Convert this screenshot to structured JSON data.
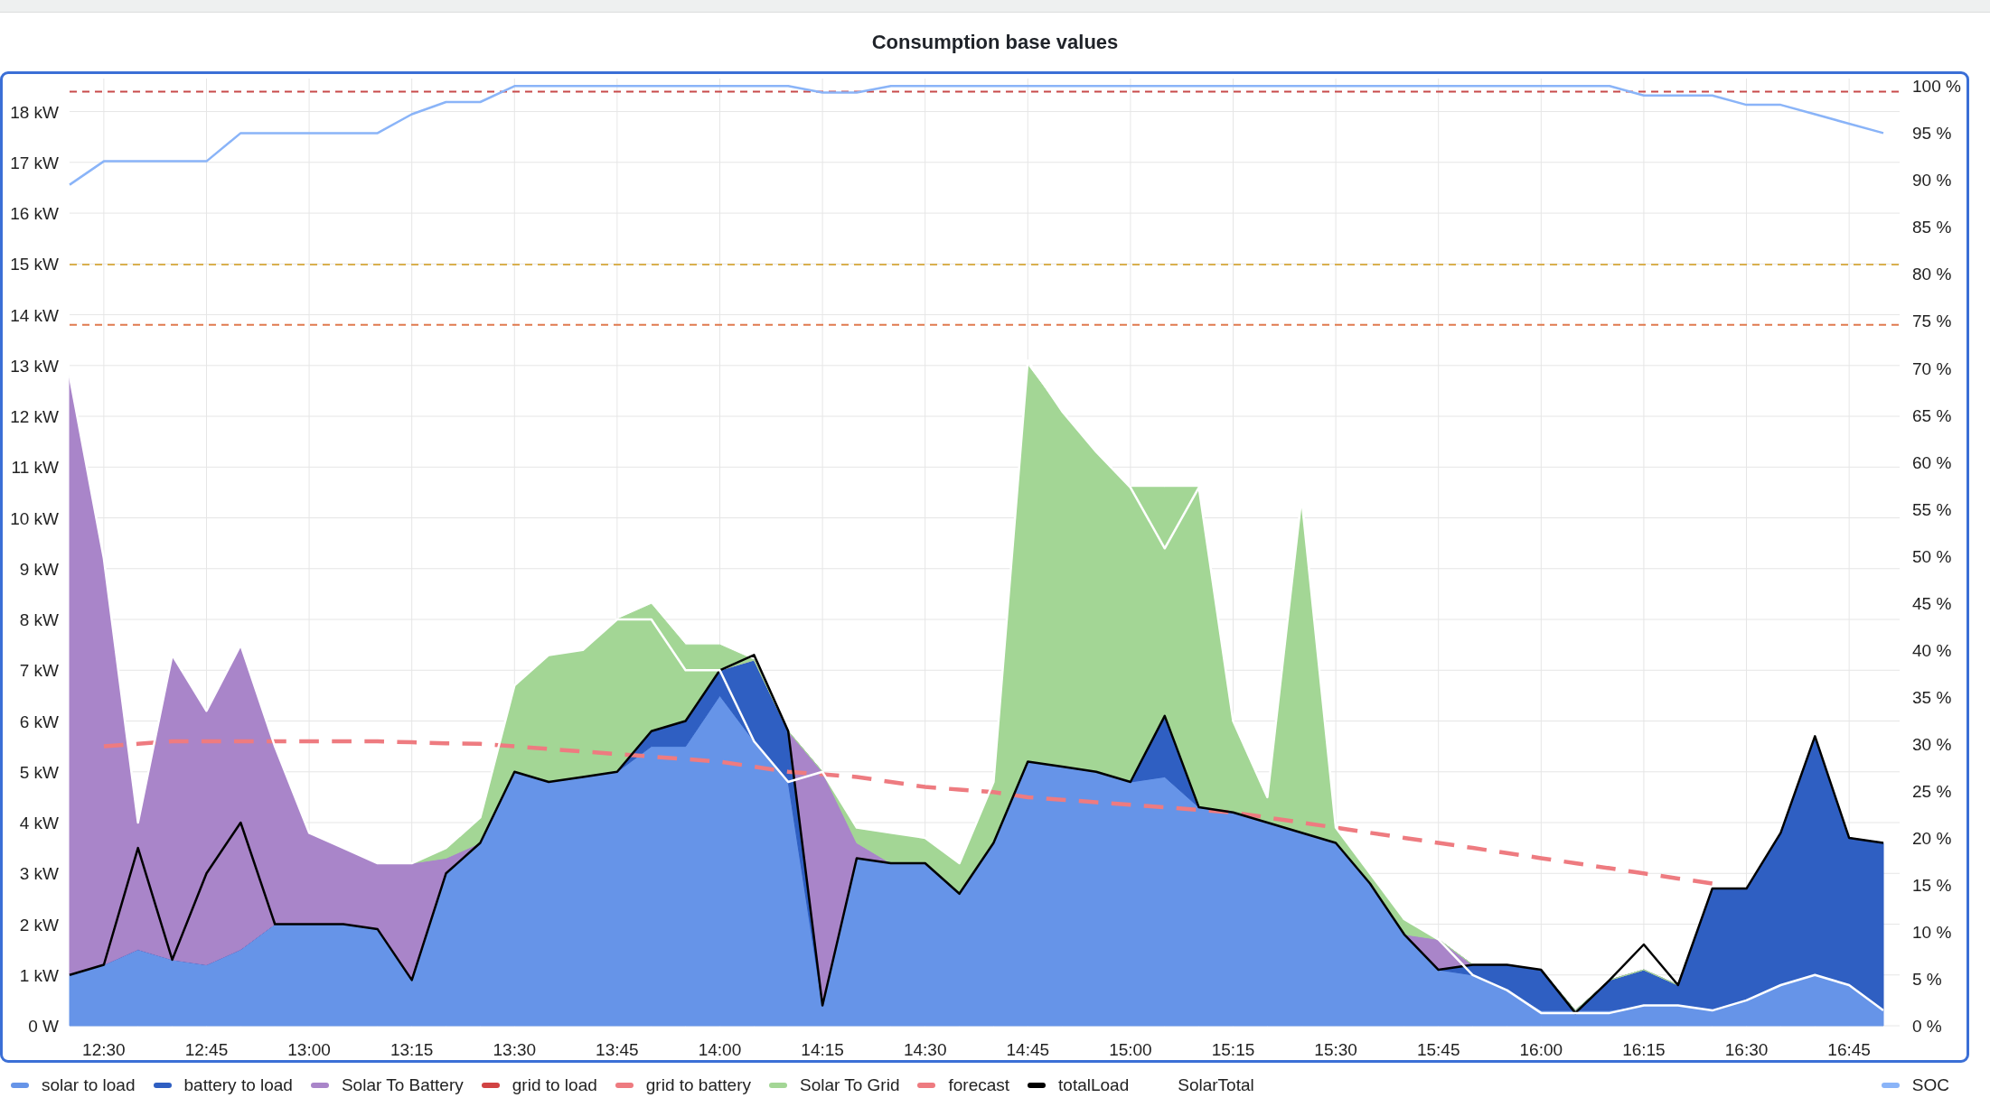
{
  "panel": {
    "title": "Consumption base values",
    "selected": true,
    "chart_data": {
      "type": "area",
      "stacked": true,
      "grid": true,
      "categories": [
        null,
        "12:30",
        null,
        null,
        "12:45",
        null,
        null,
        "13:00",
        null,
        null,
        "13:15",
        null,
        null,
        "13:30",
        null,
        null,
        "13:45",
        null,
        null,
        "14:00",
        null,
        null,
        "14:15",
        null,
        null,
        "14:30",
        null,
        null,
        "14:45",
        null,
        null,
        "15:00",
        null,
        null,
        "15:15",
        null,
        null,
        "15:30",
        null,
        null,
        "15:45",
        null,
        null,
        "16:00",
        null,
        null,
        "16:15",
        null,
        null,
        "16:30",
        null,
        null,
        "16:45",
        null
      ],
      "ylim": [
        0,
        18.65
      ],
      "yticks": [
        {
          "value": 0,
          "label": "0 W"
        },
        {
          "value": 1,
          "label": "1 kW"
        },
        {
          "value": 2,
          "label": "2 kW"
        },
        {
          "value": 3,
          "label": "3 kW"
        },
        {
          "value": 4,
          "label": "4 kW"
        },
        {
          "value": 5,
          "label": "5 kW"
        },
        {
          "value": 6,
          "label": "6 kW"
        },
        {
          "value": 7,
          "label": "7 kW"
        },
        {
          "value": 8,
          "label": "8 kW"
        },
        {
          "value": 9,
          "label": "9 kW"
        },
        {
          "value": 10,
          "label": "10 kW"
        },
        {
          "value": 11,
          "label": "11 kW"
        },
        {
          "value": 12,
          "label": "12 kW"
        },
        {
          "value": 13,
          "label": "13 kW"
        },
        {
          "value": 14,
          "label": "14 kW"
        },
        {
          "value": 15,
          "label": "15 kW"
        },
        {
          "value": 16,
          "label": "16 kW"
        },
        {
          "value": 17,
          "label": "17 kW"
        },
        {
          "value": 18,
          "label": "18 kW"
        }
      ],
      "y2lim": [
        0,
        100.8
      ],
      "y2ticks": [
        {
          "value": 0,
          "label": "0 %"
        },
        {
          "value": 5,
          "label": "5 %"
        },
        {
          "value": 10,
          "label": "10 %"
        },
        {
          "value": 15,
          "label": "15 %"
        },
        {
          "value": 20,
          "label": "20 %"
        },
        {
          "value": 25,
          "label": "25 %"
        },
        {
          "value": 30,
          "label": "30 %"
        },
        {
          "value": 35,
          "label": "35 %"
        },
        {
          "value": 40,
          "label": "40 %"
        },
        {
          "value": 45,
          "label": "45 %"
        },
        {
          "value": 50,
          "label": "50 %"
        },
        {
          "value": 55,
          "label": "55 %"
        },
        {
          "value": 60,
          "label": "60 %"
        },
        {
          "value": 65,
          "label": "65 %"
        },
        {
          "value": 70,
          "label": "70 %"
        },
        {
          "value": 75,
          "label": "75 %"
        },
        {
          "value": 80,
          "label": "80 %"
        },
        {
          "value": 85,
          "label": "85 %"
        },
        {
          "value": 90,
          "label": "90 %"
        },
        {
          "value": 95,
          "label": "95 %"
        },
        {
          "value": 100,
          "label": "100 %"
        }
      ],
      "series": [
        {
          "name": "solar to load",
          "color": "#6694e8",
          "values": [
            1.0,
            1.2,
            1.5,
            1.3,
            1.2,
            1.5,
            2.0,
            2.0,
            2.0,
            1.9,
            0.9,
            3.0,
            3.6,
            5.0,
            4.8,
            4.9,
            5.0,
            5.5,
            5.5,
            6.5,
            5.6,
            4.8,
            0.4,
            3.3,
            3.2,
            3.2,
            2.6,
            3.6,
            5.2,
            5.1,
            5.0,
            4.8,
            4.9,
            4.3,
            4.2,
            4.0,
            3.8,
            3.6,
            2.8,
            1.8,
            1.1,
            1.0,
            0.7,
            0.3,
            0.3,
            0.3,
            0.4,
            0.4,
            0.3,
            0.5,
            0.8,
            1.0,
            0.8,
            0.3
          ]
        },
        {
          "name": "battery to load",
          "color": "#2f5fc2",
          "values": [
            0,
            0,
            0,
            0,
            0,
            0,
            0,
            0,
            0,
            0,
            0,
            0,
            0,
            0,
            0,
            0,
            0,
            0.3,
            0.5,
            0.5,
            1.6,
            1.0,
            0,
            0,
            0,
            0,
            0,
            0,
            0,
            0,
            0,
            0,
            1.2,
            0,
            0,
            0,
            0,
            0,
            0,
            0,
            0,
            0.2,
            0.5,
            0.8,
            0,
            0.6,
            0.7,
            0.4,
            2.4,
            2.2,
            3.0,
            4.7,
            2.9,
            3.3
          ]
        },
        {
          "name": "Solar To Battery",
          "color": "#a985c9",
          "values": [
            11.8,
            8,
            2.5,
            6,
            5,
            6,
            3.5,
            1.8,
            1.5,
            1.3,
            2.3,
            0.3,
            0,
            0,
            0,
            0,
            0,
            0,
            0,
            0,
            0,
            0,
            4.6,
            0.3,
            0,
            0,
            0,
            0,
            0,
            0,
            0,
            0,
            0,
            0,
            0,
            0,
            0,
            0,
            0,
            0,
            0.6,
            0,
            0,
            0,
            0,
            0,
            0,
            0,
            0,
            0,
            0,
            0,
            0,
            0
          ]
        },
        {
          "name": "grid to load",
          "color": "#d14343",
          "values": [
            null,
            null,
            null,
            null,
            null,
            null,
            null,
            null,
            null,
            null,
            null,
            null,
            null,
            null,
            null,
            null,
            null,
            null,
            null,
            null,
            null,
            null,
            null,
            null,
            null,
            null,
            null,
            null,
            null,
            null,
            null,
            null,
            null,
            null,
            null,
            null,
            null,
            null,
            null,
            null,
            null,
            null,
            null,
            null,
            null,
            null,
            null,
            null,
            null,
            null,
            null,
            null,
            null,
            null
          ]
        },
        {
          "name": "grid to battery",
          "color": "#ee7b80",
          "values": [
            null,
            null,
            null,
            null,
            null,
            null,
            null,
            null,
            null,
            null,
            null,
            null,
            null,
            null,
            null,
            null,
            null,
            null,
            null,
            null,
            null,
            null,
            null,
            null,
            null,
            null,
            null,
            null,
            null,
            null,
            null,
            null,
            null,
            null,
            null,
            null,
            null,
            null,
            null,
            null,
            null,
            null,
            null,
            null,
            null,
            null,
            null,
            null,
            null,
            null,
            null,
            null,
            null,
            null
          ]
        },
        {
          "name": "Solar To Grid",
          "color": "#a3d695",
          "values": [
            0,
            0,
            0,
            0,
            0,
            0,
            0,
            0,
            0,
            0,
            0,
            0.2,
            0.5,
            1.7,
            2.5,
            2.5,
            3.0,
            2.5,
            1.5,
            0.5,
            0,
            0,
            0,
            0.3,
            0.6,
            0.5,
            0.6,
            1.2,
            7.8,
            7.0,
            6.3,
            5.8,
            4.5,
            6.3,
            1.8,
            0.5,
            6.6,
            0.3,
            0.2,
            0.3,
            0,
            0,
            0,
            0,
            0,
            0,
            0,
            0,
            0,
            0,
            0,
            0,
            0,
            0
          ]
        },
        {
          "name": "forecast",
          "color": "#ee7b80",
          "type": "line",
          "line_style": "dashed",
          "values": [
            null,
            5.5,
            5.55,
            5.6,
            5.6,
            5.6,
            5.6,
            5.6,
            5.6,
            5.6,
            5.58,
            5.56,
            5.55,
            5.5,
            5.45,
            5.4,
            5.35,
            5.3,
            5.25,
            5.2,
            5.1,
            5.0,
            4.95,
            4.9,
            4.8,
            4.7,
            4.65,
            4.6,
            4.5,
            4.45,
            4.4,
            4.35,
            4.3,
            4.25,
            4.2,
            4.1,
            4.0,
            3.9,
            3.8,
            3.7,
            3.6,
            3.5,
            3.4,
            3.3,
            3.2,
            3.1,
            3.0,
            2.9,
            2.8,
            null,
            null,
            null,
            null,
            null
          ]
        },
        {
          "name": "totalLoad",
          "color": "#000000",
          "type": "line",
          "values": [
            1.0,
            1.2,
            3.5,
            1.3,
            3.0,
            4.0,
            2.0,
            2.0,
            2.0,
            1.9,
            0.9,
            3.0,
            3.6,
            5.0,
            4.8,
            4.9,
            5.0,
            5.8,
            6.0,
            7.0,
            7.3,
            5.8,
            0.4,
            3.3,
            3.2,
            3.2,
            2.6,
            3.6,
            5.2,
            5.1,
            5.0,
            4.8,
            6.1,
            4.3,
            4.2,
            4.0,
            3.8,
            3.6,
            2.8,
            1.8,
            1.1,
            1.2,
            1.2,
            1.1,
            0.25,
            0.9,
            1.6,
            0.8,
            2.7,
            2.7,
            3.8,
            5.7,
            3.7,
            3.6
          ]
        },
        {
          "name": "SolarTotal",
          "color": "#ffffff",
          "type": "line",
          "values": [
            12.8,
            9.2,
            4.0,
            7.3,
            6.2,
            7.5,
            5.5,
            3.8,
            3.5,
            3.2,
            3.2,
            3.5,
            4.1,
            6.7,
            7.3,
            7.4,
            8.0,
            8.0,
            7.0,
            7.0,
            5.6,
            4.8,
            5.0,
            3.9,
            3.8,
            3.7,
            3.2,
            4.8,
            13.1,
            12.1,
            11.3,
            10.6,
            9.4,
            10.6,
            6.0,
            4.5,
            10.4,
            3.9,
            3.0,
            2.1,
            1.7,
            1.0,
            0.7,
            0.25,
            0.25,
            0.25,
            0.4,
            0.4,
            0.3,
            0.5,
            0.8,
            1.0,
            0.8,
            0.3
          ]
        },
        {
          "name": "SOC",
          "color": "#8ab4f8",
          "type": "line",
          "axis": "y2",
          "values": [
            89.5,
            92,
            92,
            92,
            92,
            95,
            95,
            95,
            95,
            95,
            97,
            98.3,
            98.3,
            100,
            100,
            100,
            100,
            100,
            100,
            100,
            100,
            100,
            99.3,
            99.3,
            100,
            100,
            100,
            100,
            100,
            100,
            100,
            100,
            100,
            100,
            100,
            100,
            100,
            100,
            100,
            100,
            100,
            100,
            100,
            100,
            100,
            100,
            99,
            99,
            99,
            98,
            98,
            97,
            96,
            95
          ]
        }
      ],
      "ref_lines": [
        {
          "axis": "y2",
          "value": 99.4,
          "color": "#c84a4a"
        },
        {
          "axis": "y2",
          "value": 81,
          "color": "#d9b04f"
        },
        {
          "axis": "y2",
          "value": 74.6,
          "color": "#e07a4f"
        }
      ]
    }
  }
}
